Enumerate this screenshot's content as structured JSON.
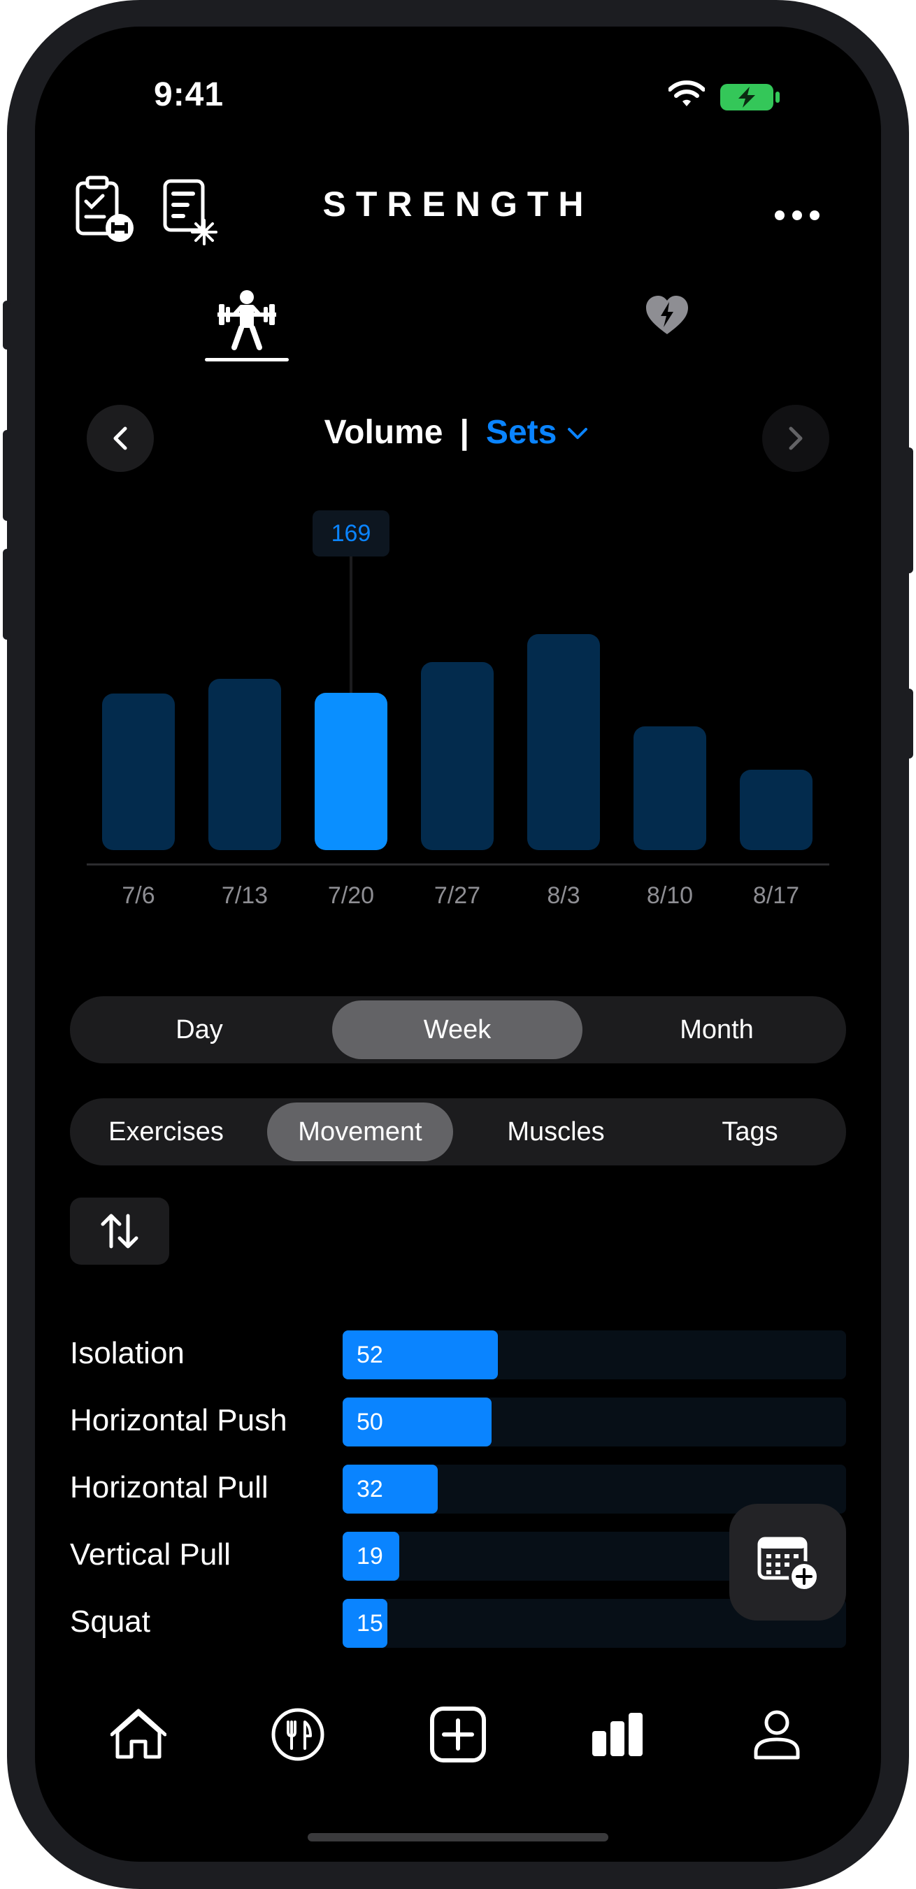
{
  "status_bar": {
    "time": "9:41"
  },
  "header": {
    "title": "STRENGTH"
  },
  "top_icons": [
    "clipboard-dumbbell-icon",
    "report-sparkle-icon",
    "more-icon"
  ],
  "tabs": [
    {
      "name": "strength-tab",
      "icon": "weightlifter-icon",
      "active": true
    },
    {
      "name": "cardio-tab",
      "icon": "heart-bolt-icon",
      "active": false
    }
  ],
  "metric": {
    "primary": "Volume",
    "separator": "|",
    "secondary": "Sets"
  },
  "chart_data": {
    "type": "bar",
    "categories": [
      "7/6",
      "7/13",
      "7/20",
      "7/27",
      "8/3",
      "8/10",
      "8/17"
    ],
    "values": [
      168,
      184,
      169,
      202,
      232,
      133,
      86
    ],
    "selected_index": 2,
    "selected_label": "169"
  },
  "period_selector": {
    "options": [
      "Day",
      "Week",
      "Month"
    ],
    "selected": "Week"
  },
  "group_selector": {
    "options": [
      "Exercises",
      "Movement",
      "Muscles",
      "Tags"
    ],
    "selected": "Movement"
  },
  "movements": [
    {
      "label": "Isolation",
      "value": 52,
      "display": "52"
    },
    {
      "label": "Horizontal Push",
      "value": 50,
      "display": "50"
    },
    {
      "label": "Horizontal Pull",
      "value": 32,
      "display": "32"
    },
    {
      "label": "Vertical Pull",
      "value": 19,
      "display": "19"
    },
    {
      "label": "Squat",
      "value": 15,
      "display": "15"
    }
  ],
  "movement_scale_max": 169,
  "colors": {
    "accent": "#0a84ff",
    "bar_dim": "#032b4d",
    "battery": "#34c759"
  },
  "bottom_nav": [
    "home-icon",
    "fork-knife-icon",
    "plus-square-icon",
    "bar-chart-icon",
    "person-icon"
  ]
}
